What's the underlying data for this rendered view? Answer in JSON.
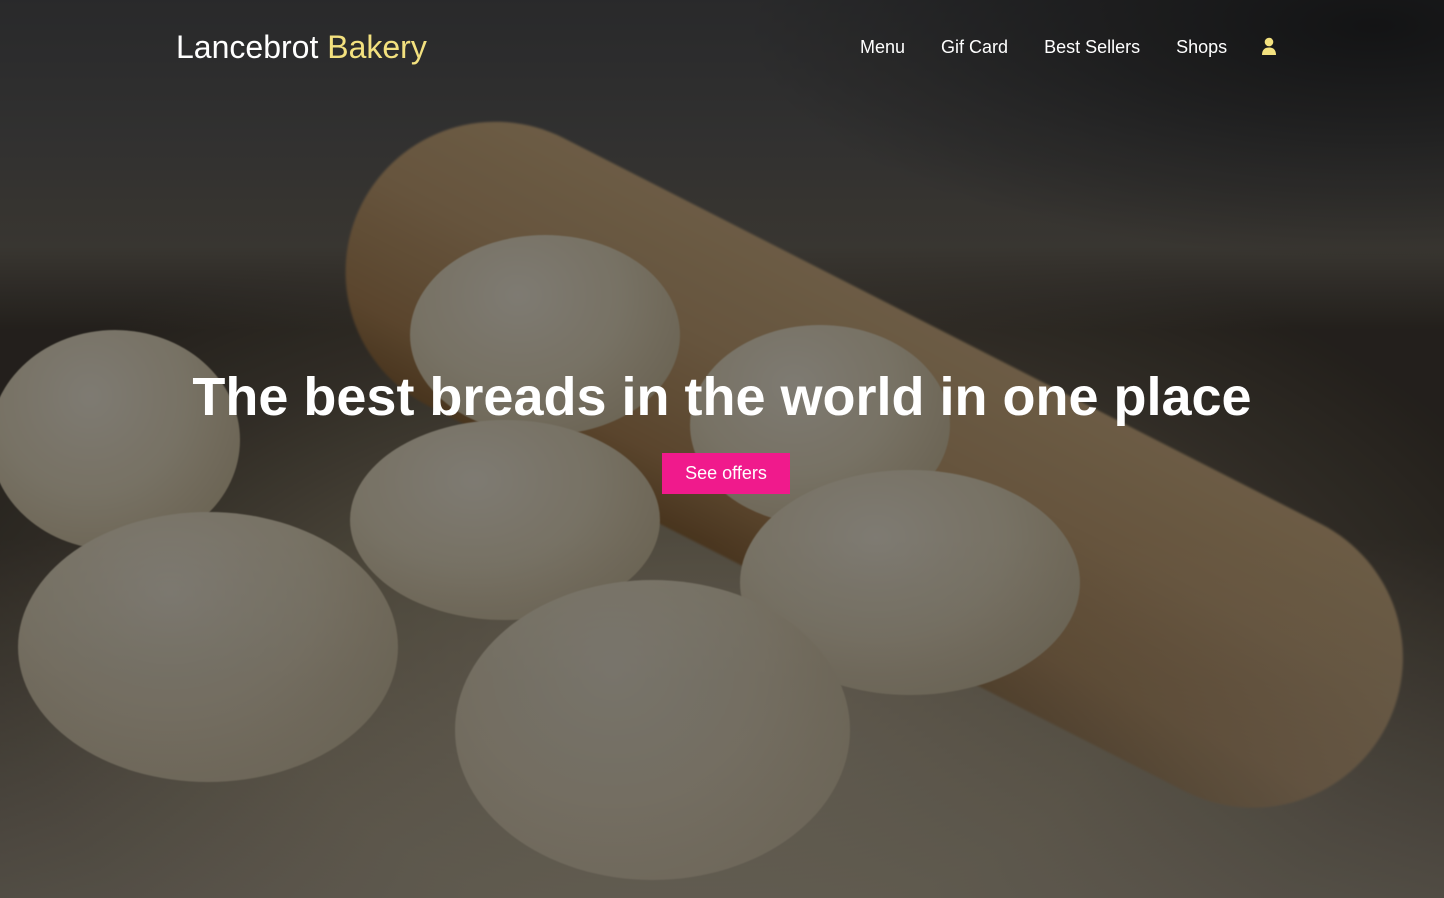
{
  "brand": {
    "name_primary": "Lancebrot",
    "name_accent": "Bakery",
    "accent_color": "#f3e17f"
  },
  "nav": {
    "items": [
      {
        "label": "Menu"
      },
      {
        "label": "Gif Card"
      },
      {
        "label": "Best Sellers"
      },
      {
        "label": "Shops"
      }
    ],
    "account_icon": "user-icon"
  },
  "hero": {
    "title": "The best breads in the world in one place",
    "cta_label": "See offers",
    "cta_color": "#f01a8c"
  }
}
